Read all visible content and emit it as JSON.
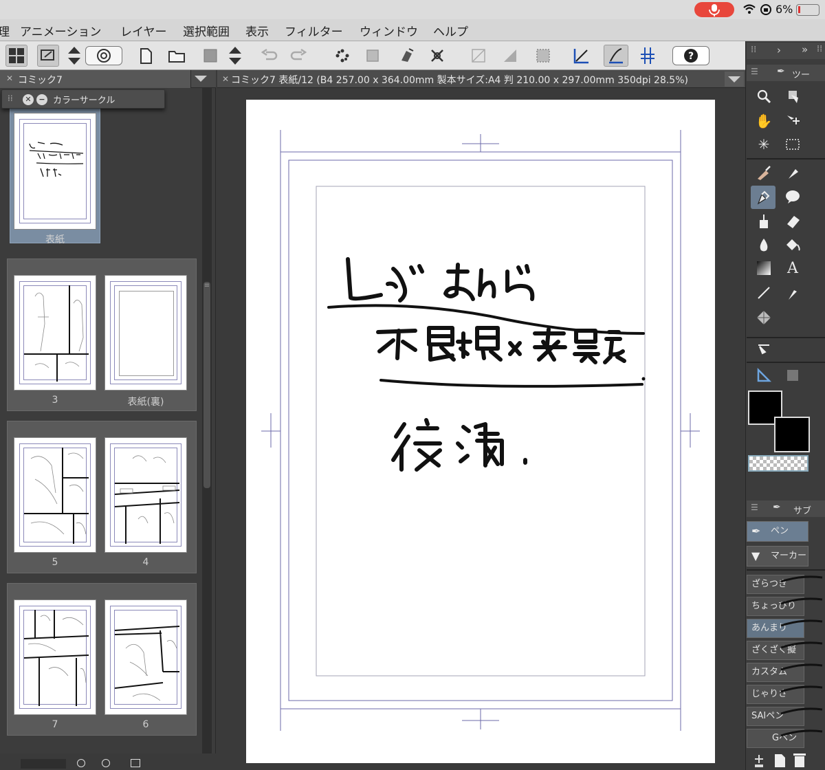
{
  "status_bar": {
    "battery": "6%"
  },
  "menubar": {
    "items": [
      "理",
      "アニメーション",
      "レイヤー",
      "選択範囲",
      "表示",
      "フィルター",
      "ウィンドウ",
      "ヘルプ"
    ]
  },
  "left_panel": {
    "tab_title": "コミック7",
    "floating_palette": "カラーサークル",
    "pages": [
      {
        "label": "表紙"
      },
      {
        "label": "3"
      },
      {
        "label": "表紙(裏)"
      },
      {
        "label": "5"
      },
      {
        "label": "4"
      },
      {
        "label": "7"
      },
      {
        "label": "6"
      }
    ],
    "cover_sketch_lines": [
      "レズまんが",
      "不良娘×委員長",
      "後編."
    ]
  },
  "canvas": {
    "title": "コミック7 表紙/12 (B4 257.00 x 364.00mm 製本サイズ:A4 判 210.00 x 297.00mm 350dpi 28.5%)",
    "handwriting": [
      "レズ まんが",
      "不良娘×委員長",
      "後編."
    ]
  },
  "right_panel": {
    "tool_header": "ツー",
    "sub_header": "サブ",
    "subtools": [
      "ペン",
      "マーカー"
    ],
    "brushes": [
      "ざらつき",
      "ちょっぴり",
      "あんまり",
      "ざくざく擬",
      "カスタム",
      "じゃりさ",
      "SAIペン",
      "Gペン"
    ],
    "selected_brush": "あんまり"
  }
}
